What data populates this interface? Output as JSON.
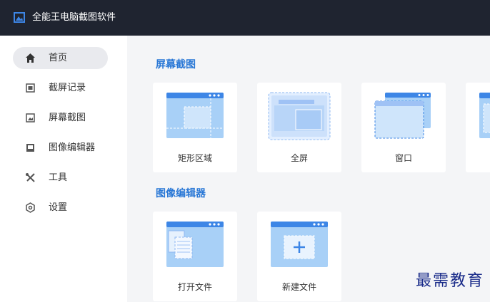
{
  "app": {
    "title": "全能王电脑截图软件",
    "logo_icon": "image-frame-icon"
  },
  "colors": {
    "accent": "#2a78d6",
    "titlebar": "#1f2430",
    "card_blue": "#a8d0f7",
    "card_header": "#3d86e6"
  },
  "sidebar": {
    "items": [
      {
        "label": "首页",
        "icon": "home-icon",
        "active": true
      },
      {
        "label": "截屏记录",
        "icon": "history-icon"
      },
      {
        "label": "屏幕截图",
        "icon": "screenshot-icon"
      },
      {
        "label": "图像编辑器",
        "icon": "image-edit-icon"
      },
      {
        "label": "工具",
        "icon": "tools-icon"
      },
      {
        "label": "设置",
        "icon": "settings-icon"
      }
    ]
  },
  "sections": {
    "screenshot": {
      "title": "屏幕截图",
      "cards": [
        {
          "label": "矩形区域",
          "icon": "rect-region-icon"
        },
        {
          "label": "全屏",
          "icon": "fullscreen-icon"
        },
        {
          "label": "窗口",
          "icon": "window-icon"
        },
        {
          "label": "",
          "icon": "scroll-window-icon"
        }
      ]
    },
    "editor": {
      "title": "图像编辑器",
      "cards": [
        {
          "label": "打开文件",
          "icon": "open-file-icon"
        },
        {
          "label": "新建文件",
          "icon": "new-file-icon"
        }
      ]
    }
  },
  "watermark": {
    "text": "最需教育"
  }
}
